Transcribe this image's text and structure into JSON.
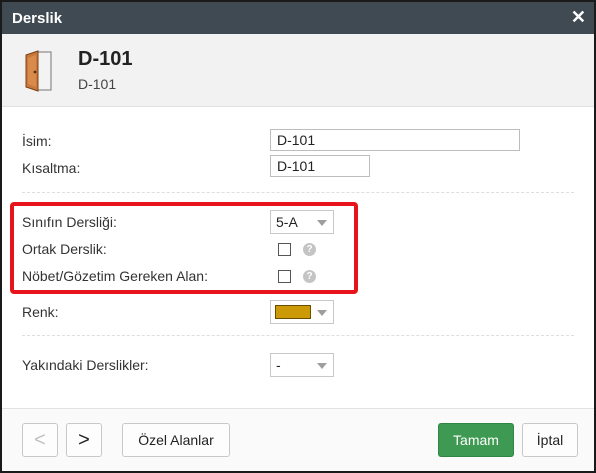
{
  "window": {
    "title": "Derslik"
  },
  "icons": {
    "close": "close-icon",
    "door": "door-icon",
    "help": "help-icon"
  },
  "header": {
    "title": "D-101",
    "subtitle": "D-101"
  },
  "form": {
    "name": {
      "label": "İsim:",
      "value": "D-101"
    },
    "short": {
      "label": "Kısaltma:",
      "value": "D-101"
    },
    "class_room": {
      "label": "Sınıfın Dersliği:",
      "value": "5-A"
    },
    "shared": {
      "label": "Ortak Derslik:",
      "checked": false
    },
    "duty": {
      "label": "Nöbet/Gözetim Gereken Alan:",
      "checked": false
    },
    "color": {
      "label": "Renk:",
      "value": "#cc9a06"
    },
    "nearby": {
      "label": "Yakındaki Derslikler:",
      "value": "-"
    }
  },
  "footer": {
    "prev": "<",
    "next": ">",
    "custom_fields": "Özel Alanlar",
    "ok": "Tamam",
    "cancel": "İptal"
  },
  "colors": {
    "titlebar": "#404a52",
    "highlight": "#e8141b",
    "primary": "#3e9a52"
  }
}
